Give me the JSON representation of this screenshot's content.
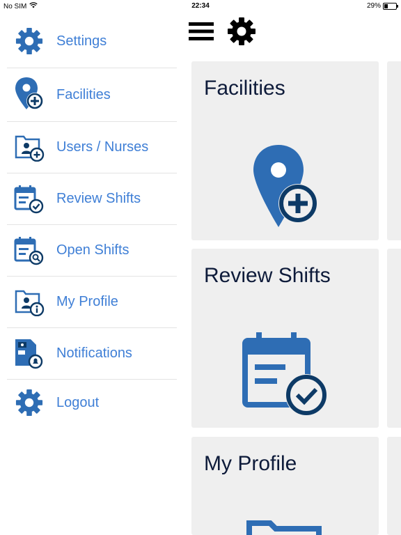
{
  "status_bar": {
    "carrier": "No SIM",
    "time": "22:34",
    "battery": "29%",
    "battery_level": 0.29
  },
  "colors": {
    "menu_text": "#3f7fd6",
    "icon_blue": "#2e6db4",
    "icon_dark": "#0d3a66",
    "card_bg": "#efefef",
    "card_title": "#0e1b3a"
  },
  "toolbar": {
    "menu_icon": "hamburger-icon",
    "settings_icon": "gear-icon"
  },
  "sidebar": {
    "items": [
      {
        "label": "Settings",
        "icon": "gear-icon"
      },
      {
        "label": "Facilities",
        "icon": "location-add-icon"
      },
      {
        "label": "Users / Nurses",
        "icon": "user-folder-add-icon"
      },
      {
        "label": "Review Shifts",
        "icon": "calendar-check-icon"
      },
      {
        "label": "Open Shifts",
        "icon": "calendar-search-icon"
      },
      {
        "label": "My Profile",
        "icon": "profile-info-icon"
      },
      {
        "label": "Notifications",
        "icon": "notification-doc-icon"
      },
      {
        "label": "Logout",
        "icon": "gear-icon"
      }
    ]
  },
  "cards": [
    {
      "title": "Facilities",
      "icon": "location-add-icon"
    },
    {
      "title": "Review Shifts",
      "icon": "calendar-check-icon"
    },
    {
      "title": "My Profile",
      "icon": "profile-folder-icon"
    }
  ]
}
